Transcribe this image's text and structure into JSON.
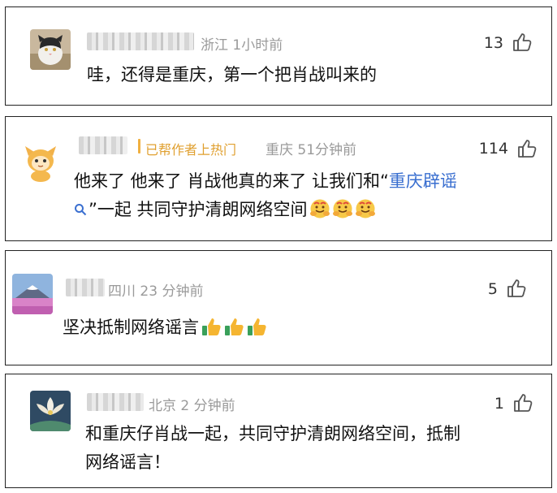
{
  "comments": [
    {
      "location_time": "浙江 1小时前",
      "likes": "13",
      "text": "哇，还得是重庆，第一个把肖战叫来的"
    },
    {
      "badge": "已帮作者上热门",
      "location_time": "重庆 51分钟前",
      "likes": "114",
      "text_line1_a": "他来了 他来了 肖战他真的来了 让我们和“",
      "text_line1_link": "重庆辟谣",
      "text_line2_b": "”一起 共同守护清朗网络空间",
      "emojis": [
        "hug-emoji",
        "hug-emoji",
        "hug-emoji"
      ]
    },
    {
      "location_time": "四川 23 分钟前",
      "likes": "5",
      "text": "坚决抵制网络谣言",
      "emojis": [
        "thumbs-up-emoji",
        "thumbs-up-emoji",
        "thumbs-up-emoji"
      ]
    },
    {
      "location_time": "北京 2 分钟前",
      "likes": "1",
      "text_line1": "和重庆仔肖战一起，共同守护清朗网络空间，抵制",
      "text_line2": "网络谣言！"
    }
  ],
  "icons": {
    "like": "thumbs-up-outline-icon",
    "search": "search-icon"
  },
  "colors": {
    "link": "#3a6fd0",
    "badge": "#e0a030",
    "meta": "#9a9a9a"
  }
}
